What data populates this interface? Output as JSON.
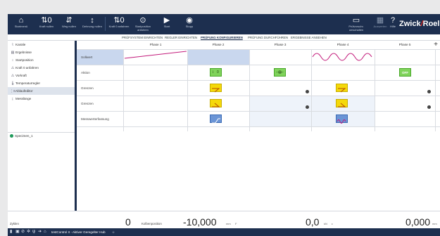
{
  "toolbar": {
    "buttons": [
      {
        "icon": "home-icon",
        "label": "Startmenü"
      },
      {
        "icon": "force-zero-icon",
        "label": "Kraft nullen"
      },
      {
        "icon": "travel-zero-icon",
        "label": "Weg nullen"
      },
      {
        "icon": "strain-zero-icon",
        "label": "Dehnung nullen"
      },
      {
        "icon": "force-zero-approach-icon",
        "label": "Kraft 0 anfahren"
      },
      {
        "icon": "start-position-icon",
        "label": "Startposition anfahren"
      },
      {
        "icon": "play-icon",
        "label": "Start"
      },
      {
        "icon": "stop-icon",
        "label": "Stopp"
      }
    ],
    "right_buttons": [
      {
        "icon": "folder-icon",
        "label": "Prüfvorschr. umschalten"
      },
      {
        "icon": "evaluate-icon",
        "label": "Auswerten"
      },
      {
        "icon": "help-icon",
        "label": "Hilfe"
      }
    ],
    "brand_left": "Zwick",
    "brand_slash": "/",
    "brand_right": "Roell"
  },
  "steps": [
    {
      "label": "PRÜFSYSTEM EINRICHTEN",
      "active": false
    },
    {
      "label": "REGLER EINRICHTEN",
      "active": false
    },
    {
      "label": "PRÜFUNG KONFIGURIEREN",
      "active": true
    },
    {
      "label": "PRÜFUNG DURCHFÜHREN",
      "active": false
    },
    {
      "label": "ERGEBNISSE ANSEHEN",
      "active": false
    }
  ],
  "sidebar": {
    "items": [
      {
        "icon": "channel-icon",
        "label": "Kanäle"
      },
      {
        "icon": "results-icon",
        "label": "Ergebnisse"
      },
      {
        "icon": "start-position-icon",
        "label": "Startposition"
      },
      {
        "icon": "force-approach-icon",
        "label": "Kraft 0 anfahren"
      },
      {
        "icon": "preload-icon",
        "label": "Vorkraft"
      },
      {
        "icon": "temperature-icon",
        "label": "Temperaturregler"
      },
      {
        "icon": "sequence-icon",
        "label": "Ablaufeditor"
      },
      {
        "icon": "measure-length-icon",
        "label": "Messlänge"
      }
    ],
    "specimen": "Specimen_1"
  },
  "grid": {
    "phases": [
      "Phase 1",
      "Phase 2",
      "Phase 3",
      "Phase 4",
      "Phase 5"
    ],
    "plus": "+",
    "rows": [
      "Sollwert",
      "Aktion",
      "Grenzen",
      "Grenzen",
      "Messwerterfassung"
    ],
    "action_off": "OFF",
    "zero_mark": "0"
  },
  "footer": {
    "label1": "Zyklen",
    "value1": "0",
    "label2": "Kolbenposition",
    "value2": "-10,000",
    "unit2": "mm",
    "sep2": "F",
    "value3": "0,0",
    "unit3": "kN",
    "sep3": "ε",
    "value4": "0,000",
    "unit4": "mm"
  },
  "status": {
    "text": "testControl II - Aktiver Geregelter Hub",
    "star": "☆"
  },
  "colors": {
    "primary": "#1d2f4f",
    "accent": "#e2231a",
    "selection": "#c9d7ee",
    "sine": "#c2197a"
  }
}
